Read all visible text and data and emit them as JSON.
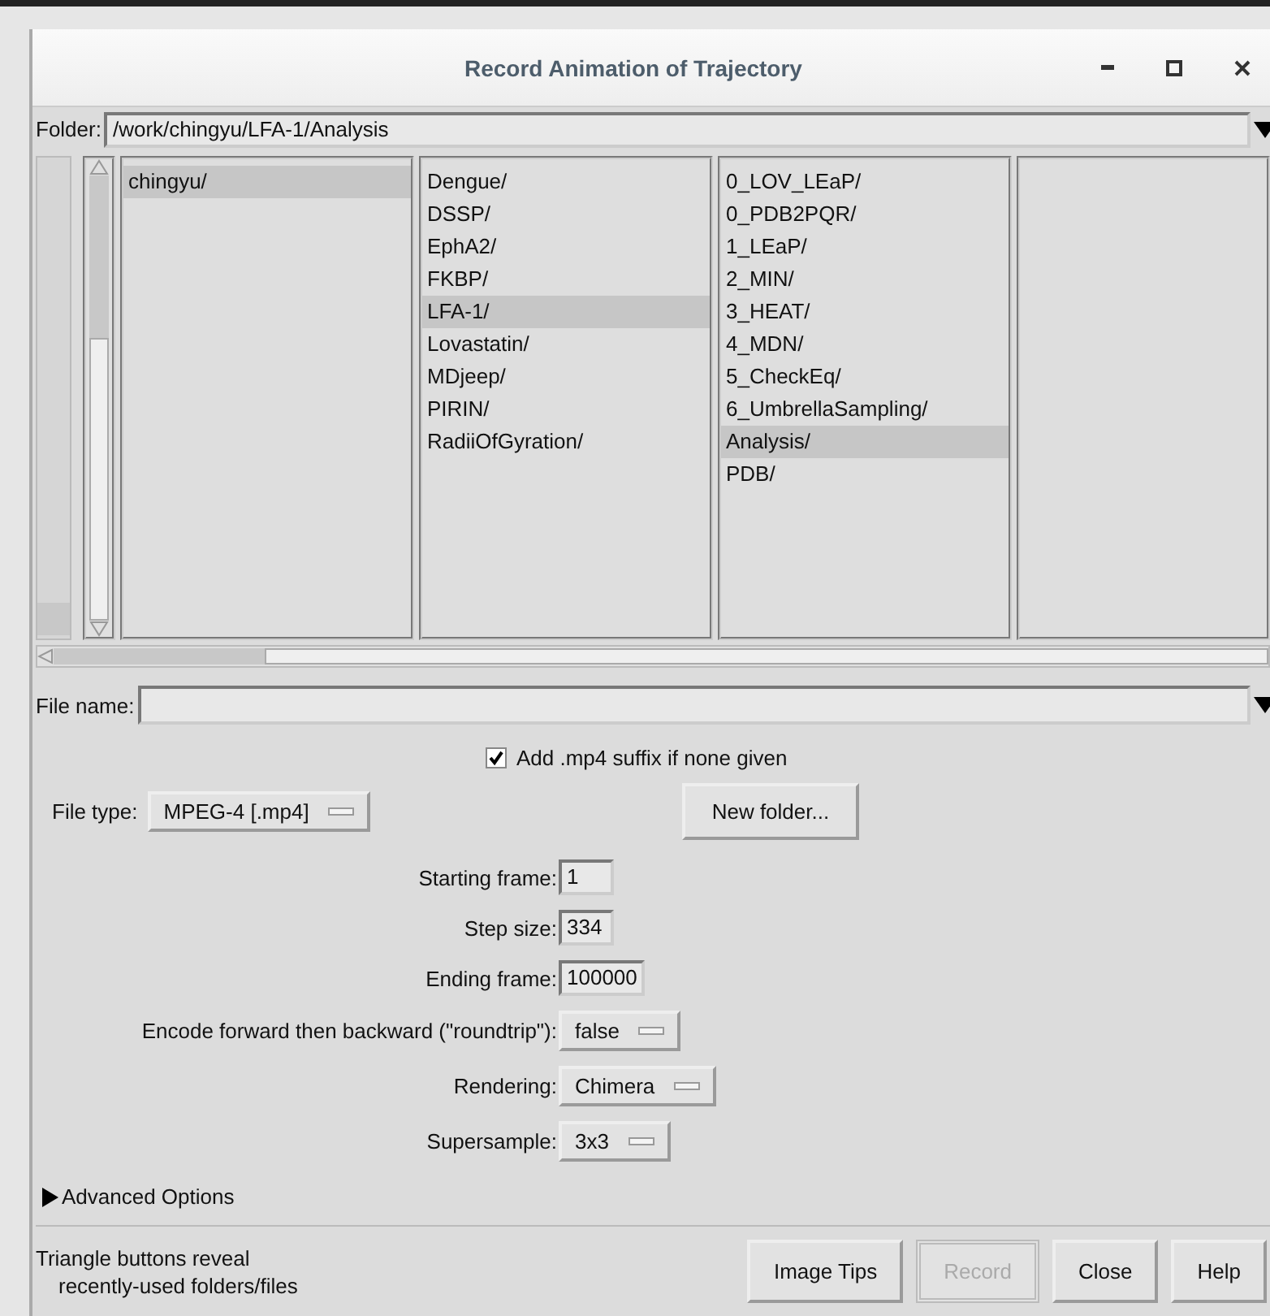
{
  "window": {
    "title": "Record Animation of Trajectory"
  },
  "folder": {
    "label": "Folder:",
    "value": "/work/chingyu/LFA-1/Analysis"
  },
  "browser": {
    "columns": [
      [
        {
          "name": "chingyu/",
          "selected": true
        }
      ],
      [
        {
          "name": "Dengue/",
          "selected": false
        },
        {
          "name": "DSSP/",
          "selected": false
        },
        {
          "name": "EphA2/",
          "selected": false
        },
        {
          "name": "FKBP/",
          "selected": false
        },
        {
          "name": "LFA-1/",
          "selected": true
        },
        {
          "name": "Lovastatin/",
          "selected": false
        },
        {
          "name": "MDjeep/",
          "selected": false
        },
        {
          "name": "PIRIN/",
          "selected": false
        },
        {
          "name": "RadiiOfGyration/",
          "selected": false
        }
      ],
      [
        {
          "name": "0_LOV_LEaP/",
          "selected": false
        },
        {
          "name": "0_PDB2PQR/",
          "selected": false
        },
        {
          "name": "1_LEaP/",
          "selected": false
        },
        {
          "name": "2_MIN/",
          "selected": false
        },
        {
          "name": "3_HEAT/",
          "selected": false
        },
        {
          "name": "4_MDN/",
          "selected": false
        },
        {
          "name": "5_CheckEq/",
          "selected": false
        },
        {
          "name": "6_UmbrellaSampling/",
          "selected": false
        },
        {
          "name": "Analysis/",
          "selected": true
        },
        {
          "name": "PDB/",
          "selected": false
        }
      ],
      []
    ]
  },
  "file_name": {
    "label": "File name:"
  },
  "suffix_option": {
    "label": "Add .mp4 suffix if none given",
    "checked": true
  },
  "file_type": {
    "label": "File type:",
    "value": "MPEG-4 [.mp4]"
  },
  "new_folder_button": "New folder...",
  "fields": [
    {
      "kind": "entry",
      "label": "Starting frame:",
      "value": "1"
    },
    {
      "kind": "entry",
      "label": "Step size:",
      "value": "334"
    },
    {
      "kind": "entry",
      "label": "Ending frame:",
      "value": "100000"
    },
    {
      "kind": "menu",
      "label": "Encode forward then backward (\"roundtrip\"):",
      "value": "false"
    },
    {
      "kind": "menu",
      "label": "Rendering:",
      "value": "Chimera"
    },
    {
      "kind": "menu",
      "label": "Supersample:",
      "value": "3x3"
    }
  ],
  "advanced": {
    "label": "Advanced Options",
    "expanded": false
  },
  "hint": [
    "Triangle buttons reveal",
    "recently-used folders/files"
  ],
  "buttons": [
    {
      "label": "Image Tips",
      "disabled": false
    },
    {
      "label": "Record",
      "disabled": true
    },
    {
      "label": "Close",
      "disabled": false
    },
    {
      "label": "Help",
      "disabled": false
    }
  ]
}
